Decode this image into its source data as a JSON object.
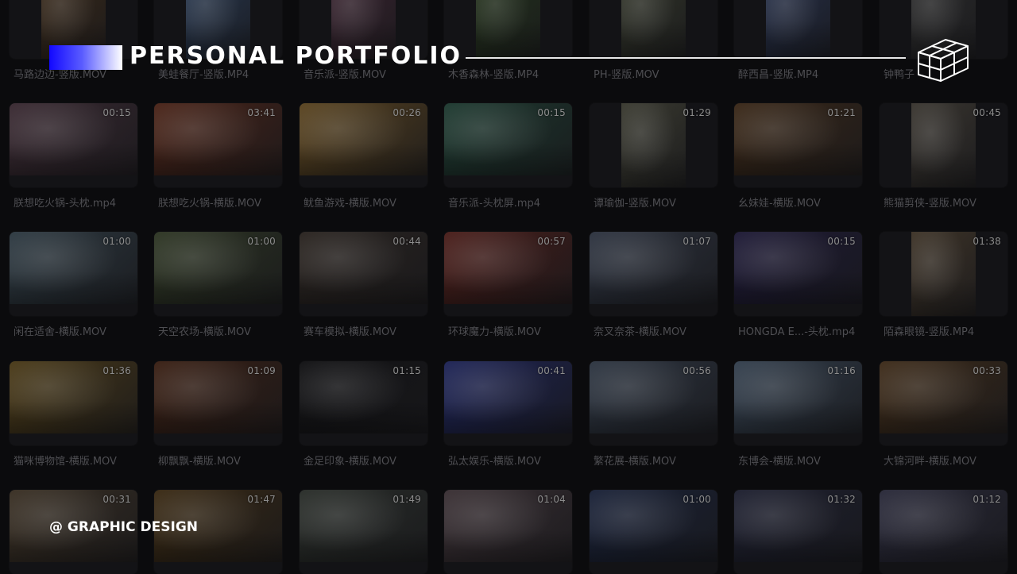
{
  "header": {
    "title": "PERSONAL  PORTFOLIO",
    "cube_icon": "wireframe-cube-icon",
    "accent_colors": [
      "#1208ff",
      "#5a5cff",
      "#ffffff"
    ]
  },
  "footer": {
    "label": "@ GRAPHIC DESIGN"
  },
  "videos": [
    {
      "row": 0,
      "col": 0,
      "name": "马路边边-竖版.MOV",
      "duration": "",
      "orientation": "portrait",
      "color": "#3a2a1a"
    },
    {
      "row": 0,
      "col": 1,
      "name": "美蛙餐厅-竖版.MP4",
      "duration": "",
      "orientation": "portrait",
      "color": "#283850"
    },
    {
      "row": 0,
      "col": 2,
      "name": "音乐派-竖版.MOV",
      "duration": "",
      "orientation": "portrait",
      "color": "#3a2430"
    },
    {
      "row": 0,
      "col": 3,
      "name": "木香森林-竖版.MP4",
      "duration": "",
      "orientation": "portrait",
      "color": "#24331c"
    },
    {
      "row": 0,
      "col": 4,
      "name": "PH-竖版.MOV",
      "duration": "",
      "orientation": "portrait",
      "color": "#33362a"
    },
    {
      "row": 0,
      "col": 5,
      "name": "醉西昌-竖版.MP4",
      "duration": "",
      "orientation": "portrait",
      "color": "#26304a"
    },
    {
      "row": 0,
      "col": 6,
      "name": "钟鸭子",
      "duration": "",
      "orientation": "portrait",
      "color": "#2c2c2c"
    },
    {
      "row": 1,
      "col": 0,
      "name": "朕想吃火锅-头枕.mp4",
      "duration": "00:15",
      "orientation": "landscape",
      "color": "#3a2a32"
    },
    {
      "row": 1,
      "col": 1,
      "name": "朕想吃火锅-横版.MOV",
      "duration": "03:41",
      "orientation": "landscape",
      "color": "#4a2418"
    },
    {
      "row": 1,
      "col": 2,
      "name": "鱿鱼游戏-横版.MOV",
      "duration": "00:26",
      "orientation": "landscape",
      "color": "#5a4420"
    },
    {
      "row": 1,
      "col": 3,
      "name": "音乐派-头枕屏.mp4",
      "duration": "00:15",
      "orientation": "landscape",
      "color": "#1e3a30"
    },
    {
      "row": 1,
      "col": 4,
      "name": "谭瑜伽-竖版.MOV",
      "duration": "01:29",
      "orientation": "portrait",
      "color": "#3a3a30"
    },
    {
      "row": 1,
      "col": 5,
      "name": "幺妹娃-横版.MOV",
      "duration": "01:21",
      "orientation": "landscape",
      "color": "#3a2818"
    },
    {
      "row": 1,
      "col": 6,
      "name": "熊猫剪侠-竖版.MOV",
      "duration": "00:45",
      "orientation": "portrait",
      "color": "#3a3630"
    },
    {
      "row": 2,
      "col": 0,
      "name": "闲在适舍-横版.MOV",
      "duration": "01:00",
      "orientation": "landscape",
      "color": "#2e3a42"
    },
    {
      "row": 2,
      "col": 1,
      "name": "天空农场-横版.MOV",
      "duration": "01:00",
      "orientation": "landscape",
      "color": "#2e3624"
    },
    {
      "row": 2,
      "col": 2,
      "name": "赛车模拟-横版.MOV",
      "duration": "00:44",
      "orientation": "landscape",
      "color": "#2a2420"
    },
    {
      "row": 2,
      "col": 3,
      "name": "环球魔力-横版.MOV",
      "duration": "00:57",
      "orientation": "landscape",
      "color": "#4a1e1a"
    },
    {
      "row": 2,
      "col": 4,
      "name": "奈叉奈茶-横版.MOV",
      "duration": "01:07",
      "orientation": "landscape",
      "color": "#2e3440"
    },
    {
      "row": 2,
      "col": 5,
      "name": "HONGDA E...-头枕.mp4",
      "duration": "00:15",
      "orientation": "landscape",
      "color": "#1e1a36"
    },
    {
      "row": 2,
      "col": 6,
      "name": "陌森眼镜-竖版.MP4",
      "duration": "01:38",
      "orientation": "portrait",
      "color": "#3e3428"
    },
    {
      "row": 3,
      "col": 0,
      "name": "猫咪博物馆-横版.MOV",
      "duration": "01:36",
      "orientation": "landscape",
      "color": "#4a3a18"
    },
    {
      "row": 3,
      "col": 1,
      "name": "柳飘飘-横版.MOV",
      "duration": "01:09",
      "orientation": "landscape",
      "color": "#3a2014"
    },
    {
      "row": 3,
      "col": 2,
      "name": "金足印象-横版.MOV",
      "duration": "01:15",
      "orientation": "landscape",
      "color": "#121214"
    },
    {
      "row": 3,
      "col": 3,
      "name": "弘太娱乐-横版.MOV",
      "duration": "00:41",
      "orientation": "landscape",
      "color": "#1e2456"
    },
    {
      "row": 3,
      "col": 4,
      "name": "繁花展-横版.MOV",
      "duration": "00:56",
      "orientation": "landscape",
      "color": "#2e3642"
    },
    {
      "row": 3,
      "col": 5,
      "name": "东博会-横版.MOV",
      "duration": "01:16",
      "orientation": "landscape",
      "color": "#34404e"
    },
    {
      "row": 3,
      "col": 6,
      "name": "大锦河畔-横版.MOV",
      "duration": "00:33",
      "orientation": "landscape",
      "color": "#3e2c1a"
    },
    {
      "row": 4,
      "col": 0,
      "name": "",
      "duration": "00:31",
      "orientation": "landscape",
      "color": "#3a3024"
    },
    {
      "row": 4,
      "col": 1,
      "name": "",
      "duration": "01:47",
      "orientation": "landscape",
      "color": "#3a2a14"
    },
    {
      "row": 4,
      "col": 2,
      "name": "",
      "duration": "01:49",
      "orientation": "landscape",
      "color": "#2a2e2a"
    },
    {
      "row": 4,
      "col": 3,
      "name": "",
      "duration": "01:04",
      "orientation": "landscape",
      "color": "#3a3034"
    },
    {
      "row": 4,
      "col": 4,
      "name": "",
      "duration": "01:00",
      "orientation": "landscape",
      "color": "#1a2238"
    },
    {
      "row": 4,
      "col": 5,
      "name": "",
      "duration": "01:32",
      "orientation": "landscape",
      "color": "#1e2030"
    },
    {
      "row": 4,
      "col": 6,
      "name": "",
      "duration": "01:12",
      "orientation": "landscape",
      "color": "#2a2a3a"
    }
  ]
}
